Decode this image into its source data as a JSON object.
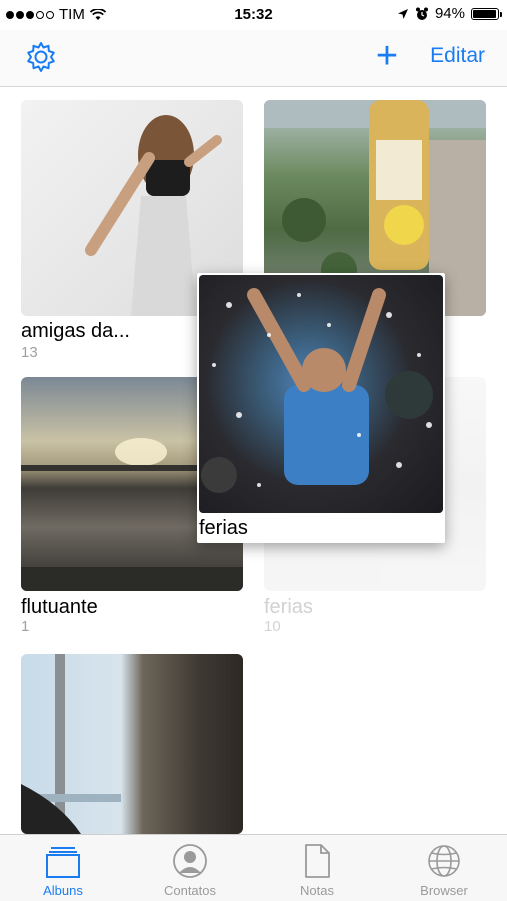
{
  "status_bar": {
    "carrier": "TIM",
    "time": "15:32",
    "battery": "94%",
    "battery_level": 0.94,
    "signal_filled": 3,
    "signal_total": 5
  },
  "nav": {
    "settings_icon": "gear-icon",
    "add_label": "+",
    "edit_label": "Editar"
  },
  "albums": [
    {
      "title": "amigas da...",
      "count": "13"
    },
    {
      "title": "",
      "count": ""
    },
    {
      "title": "flutuante",
      "count": "1"
    },
    {
      "title": "ferias",
      "count": "10"
    },
    {
      "title": "",
      "count": ""
    }
  ],
  "dragging": {
    "title": "ferias"
  },
  "tabs": [
    {
      "label": "Albuns",
      "icon": "albums-icon",
      "active": true
    },
    {
      "label": "Contatos",
      "icon": "contact-icon",
      "active": false
    },
    {
      "label": "Notas",
      "icon": "note-icon",
      "active": false
    },
    {
      "label": "Browser",
      "icon": "globe-icon",
      "active": false
    }
  ],
  "colors": {
    "accent": "#1a7cf3",
    "inactive": "#9a9a9a"
  }
}
